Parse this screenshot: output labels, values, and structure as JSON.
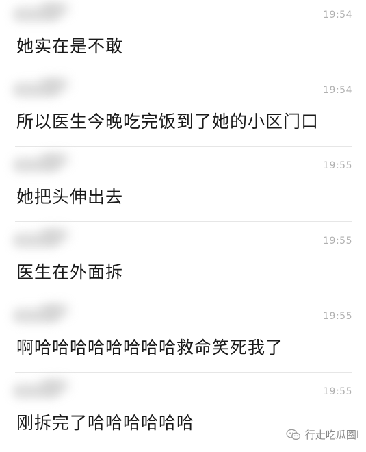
{
  "messages": [
    {
      "time": "19:54",
      "text": "她实在是不敢"
    },
    {
      "time": "19:54",
      "text": "所以医生今晚吃完饭到了她的小区门口"
    },
    {
      "time": "19:55",
      "text": "她把头伸出去"
    },
    {
      "time": "19:55",
      "text": "医生在外面拆"
    },
    {
      "time": "19:55",
      "text": "啊哈哈哈哈哈哈哈哈救命笑死我了"
    },
    {
      "time": "19:55",
      "text": "刚拆完了哈哈哈哈哈哈"
    }
  ],
  "watermark": {
    "label": "行走吃瓜圈l",
    "icon": "wechat-icon"
  }
}
